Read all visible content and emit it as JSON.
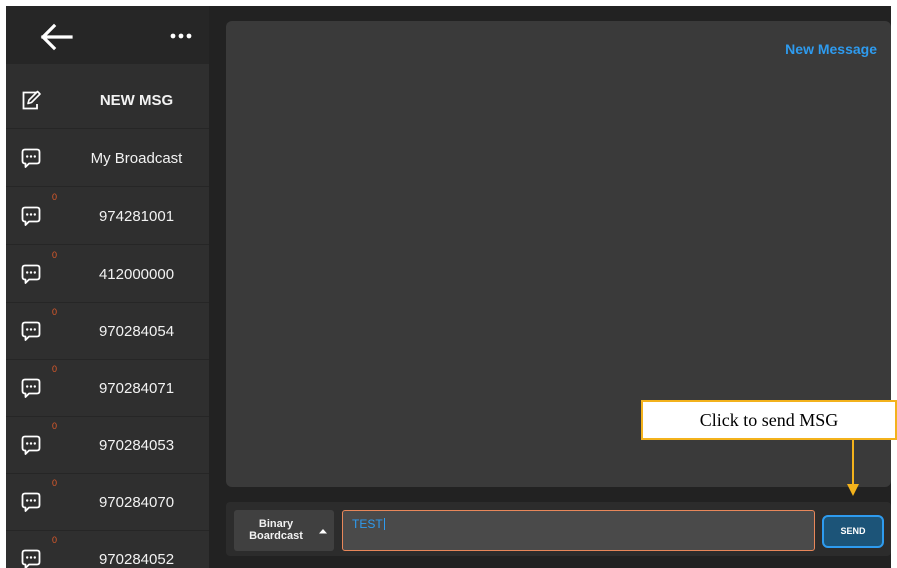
{
  "header": {
    "back_icon": "arrow-left-icon",
    "menu_icon": "more-horizontal-icon"
  },
  "sidebar": {
    "items": [
      {
        "label": "NEW MSG",
        "icon": "compose-icon",
        "badge": ""
      },
      {
        "label": "My Broadcast",
        "icon": "chat-bubble-icon",
        "badge": ""
      },
      {
        "label": "974281001",
        "icon": "chat-bubble-icon",
        "badge": "0"
      },
      {
        "label": "412000000",
        "icon": "chat-bubble-icon",
        "badge": "0"
      },
      {
        "label": "970284054",
        "icon": "chat-bubble-icon",
        "badge": "0"
      },
      {
        "label": "970284071",
        "icon": "chat-bubble-icon",
        "badge": "0"
      },
      {
        "label": "970284053",
        "icon": "chat-bubble-icon",
        "badge": "0"
      },
      {
        "label": "970284070",
        "icon": "chat-bubble-icon",
        "badge": "0"
      },
      {
        "label": "970284052",
        "icon": "chat-bubble-icon",
        "badge": "0"
      }
    ]
  },
  "main": {
    "new_message_link": "New Message"
  },
  "composer": {
    "mode_line1": "Binary",
    "mode_line2": "Boardcast",
    "input_value": "TEST",
    "send_label": "SEND"
  },
  "annotation": {
    "callout_text": "Click to send MSG"
  },
  "colors": {
    "accent": "#2e9bef",
    "badge": "#e05a2a",
    "input_border": "#e8875a",
    "callout_border": "#f3b21c",
    "sidebar_bg": "#2f2f2f",
    "panel_bg": "#3a3a3a"
  }
}
